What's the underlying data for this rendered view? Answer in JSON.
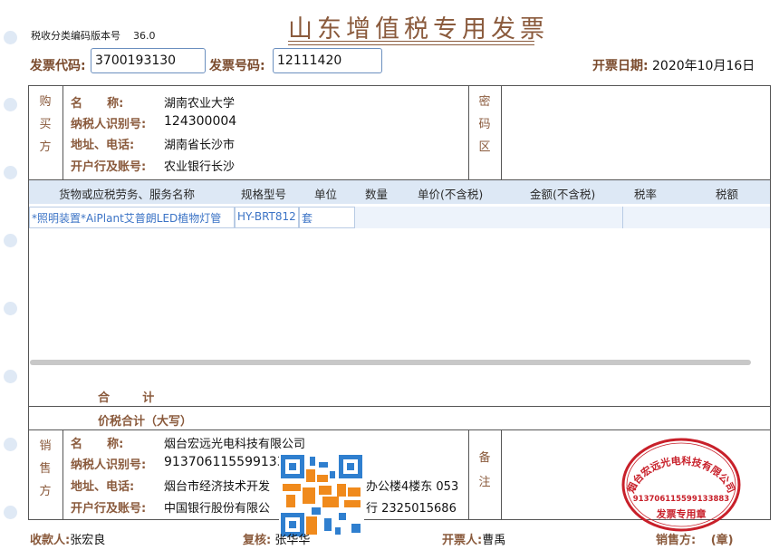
{
  "invoice": {
    "version_label": "税收分类编码版本号",
    "version_value": "36.0",
    "title": "山东增值税专用发票",
    "code_label": "发票代码:",
    "code_value": "3700193130",
    "number_label": "发票号码:",
    "number_value": "12111420",
    "date_label": "开票日期:",
    "date_value": "2020年10月16日"
  },
  "buyer": {
    "section_chars": [
      "购",
      "买",
      "方"
    ],
    "name_label": "名      称:",
    "name_value": "湖南农业大学",
    "taxid_label": "纳税人识别号:",
    "taxid_value": "124300004",
    "addr_label": "地址、电话:",
    "addr_value": "湖南省长沙市",
    "bank_label": "开户行及账号:",
    "bank_value": "农业银行长沙"
  },
  "password_area": {
    "chars": [
      "密",
      "码",
      "区"
    ]
  },
  "goods": {
    "columns": [
      "货物或应税劳务、服务名称",
      "规格型号",
      "单位",
      "数量",
      "单价(不含税)",
      "金额(不含税)",
      "税率",
      "税额"
    ],
    "rows": [
      {
        "name": "*照明装置*AiPlant艾普朗LED植物灯管",
        "spec": "HY-BRT812",
        "unit": "套",
        "qty": "",
        "price": "",
        "amount": "",
        "rate": "",
        "tax": ""
      }
    ]
  },
  "totals": {
    "sum_label": "合        计",
    "total_label": "价税合计（大写）"
  },
  "seller": {
    "section_chars": [
      "销",
      "售",
      "方"
    ],
    "name_label": "名      称:",
    "name_value": "烟台宏远光电科技有限公司",
    "taxid_label": "纳税人识别号:",
    "taxid_value": "9137061155991338",
    "addr_label": "地址、电话:",
    "addr_value": "烟台市经济技术开发",
    "addr_value_tail": "办公楼4楼东 053",
    "bank_label": "开户行及账号:",
    "bank_value": "中国银行股份有限公",
    "bank_value_tail": "行  2325015686"
  },
  "remarks": {
    "chars": [
      "备",
      "注"
    ]
  },
  "stamp": {
    "company": "烟台宏远光电科技有限公司",
    "taxid": "913706115599133883",
    "type": "发票专用章"
  },
  "footer": {
    "payee_label": "收款人:",
    "payee_value": "张宏良",
    "review_label": "复核:",
    "review_value": "张华华",
    "drawer_label": "开票人:",
    "drawer_value": "曹禹",
    "seller_label": "销售方:",
    "seal_label": "(章)"
  },
  "colors": {
    "label_brown": "#8a5a3c",
    "header_blue": "#dde8f5",
    "item_blue": "#3c74c6",
    "stamp_red": "#c8202a"
  }
}
